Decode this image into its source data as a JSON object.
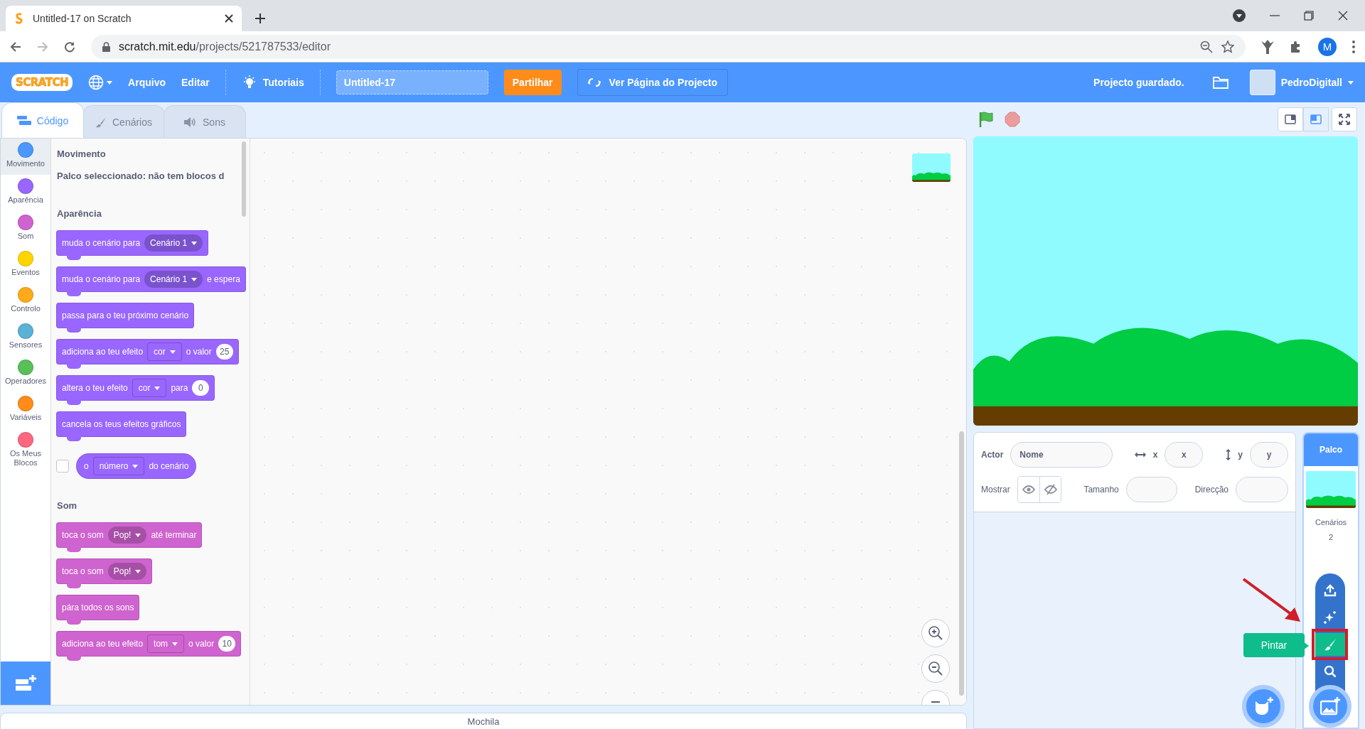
{
  "browser": {
    "tab_title": "Untitled-17 on Scratch",
    "url_host": "scratch.mit.edu",
    "url_path": "/projects/521787533/editor",
    "profile_initial": "M"
  },
  "menu_bar": {
    "logo": "SCRATCH",
    "items": [
      "Arquivo",
      "Editar"
    ],
    "tutorials": "Tutoriais",
    "project_title": "Untitled-17",
    "share": "Partilhar",
    "project_page": "Ver Página do Projecto",
    "save_status": "Projecto guardado.",
    "username": "PedroDigitall"
  },
  "tabs": [
    {
      "label": "Código",
      "kind": "code",
      "selected": true
    },
    {
      "label": "Cenários",
      "kind": "costumes",
      "selected": false
    },
    {
      "label": "Sons",
      "kind": "sounds",
      "selected": false
    }
  ],
  "categories": [
    {
      "label": "Movimento",
      "color": "#4c97ff",
      "selected": true
    },
    {
      "label": "Aparência",
      "color": "#9966ff",
      "selected": false
    },
    {
      "label": "Som",
      "color": "#cf63cf",
      "selected": false
    },
    {
      "label": "Eventos",
      "color": "#ffd500",
      "selected": false
    },
    {
      "label": "Controlo",
      "color": "#ffab19",
      "selected": false
    },
    {
      "label": "Sensores",
      "color": "#5cb1d6",
      "selected": false
    },
    {
      "label": "Operadores",
      "color": "#59c059",
      "selected": false
    },
    {
      "label": "Variáveis",
      "color": "#ff8c1a",
      "selected": false
    },
    {
      "label": "Os Meus Blocos",
      "color": "#ff6680",
      "selected": false
    }
  ],
  "palette": [
    {
      "title": "Movimento",
      "note": "Palco seleccionado: não tem blocos d"
    },
    {
      "title": "Aparência",
      "color": "#9966ff",
      "blocks": [
        {
          "kind": "stack",
          "parts": [
            {
              "kind": "text",
              "text": "muda o cenário para"
            },
            {
              "kind": "menu",
              "text": "Cenário 1"
            }
          ]
        },
        {
          "kind": "stack",
          "parts": [
            {
              "kind": "text",
              "text": "muda o cenário para"
            },
            {
              "kind": "menu",
              "text": "Cenário 1"
            },
            {
              "kind": "text",
              "text": "e espera"
            }
          ]
        },
        {
          "kind": "stack",
          "parts": [
            {
              "kind": "text",
              "text": "passa para o teu próximo cenário"
            }
          ]
        },
        {
          "kind": "stack",
          "parts": [
            {
              "kind": "text",
              "text": "adiciona ao teu efeito"
            },
            {
              "kind": "field",
              "text": "cor"
            },
            {
              "kind": "text",
              "text": "o valor"
            },
            {
              "kind": "number",
              "text": "25"
            }
          ]
        },
        {
          "kind": "stack",
          "parts": [
            {
              "kind": "text",
              "text": "altera o teu efeito"
            },
            {
              "kind": "field",
              "text": "cor"
            },
            {
              "kind": "text",
              "text": "para"
            },
            {
              "kind": "number",
              "text": "0"
            }
          ]
        },
        {
          "kind": "stack",
          "parts": [
            {
              "kind": "text",
              "text": "cancela os teus efeitos gráficos"
            }
          ]
        },
        {
          "kind": "reporter",
          "checked": false,
          "parts": [
            {
              "kind": "text",
              "text": "o"
            },
            {
              "kind": "field",
              "text": "número"
            },
            {
              "kind": "text",
              "text": "do cenário"
            }
          ]
        }
      ]
    },
    {
      "title": "Som",
      "color": "#cf63cf",
      "blocks": [
        {
          "kind": "stack",
          "parts": [
            {
              "kind": "text",
              "text": "toca o som"
            },
            {
              "kind": "menu",
              "text": "Pop!"
            },
            {
              "kind": "text",
              "text": "até terminar"
            }
          ]
        },
        {
          "kind": "stack",
          "parts": [
            {
              "kind": "text",
              "text": "toca o som"
            },
            {
              "kind": "menu",
              "text": "Pop!"
            }
          ]
        },
        {
          "kind": "stack",
          "parts": [
            {
              "kind": "text",
              "text": "pára todos os sons"
            }
          ]
        },
        {
          "kind": "stack",
          "parts": [
            {
              "kind": "text",
              "text": "adiciona ao teu efeito"
            },
            {
              "kind": "field",
              "text": "tom"
            },
            {
              "kind": "text",
              "text": "o valor"
            },
            {
              "kind": "number",
              "text": "10"
            }
          ]
        }
      ]
    }
  ],
  "stage_layouts": [
    {
      "kind": "small",
      "selected": false
    },
    {
      "kind": "normal",
      "selected": true
    }
  ],
  "sprite_info": {
    "actor_label": "Actor",
    "name_placeholder": "Nome",
    "x_label": "x",
    "x_placeholder": "x",
    "y_label": "y",
    "y_placeholder": "y",
    "show_label": "Mostrar",
    "size_label": "Tamanho",
    "direction_label": "Direcção"
  },
  "stage_selector": {
    "title": "Palco",
    "backdrops_label": "Cenários",
    "backdrops_count": "2",
    "tooltip": "Pintar"
  },
  "backpack": "Mochila"
}
